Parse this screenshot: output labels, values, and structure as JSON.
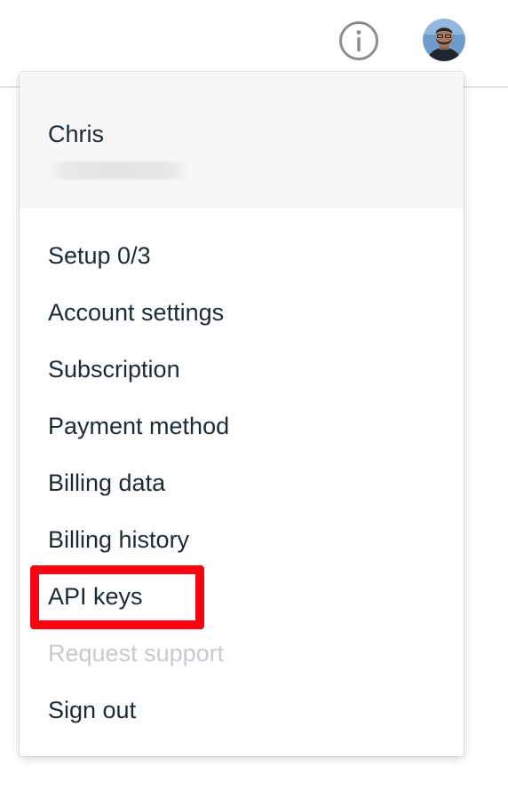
{
  "header": {
    "info_icon": "info-circle-icon",
    "avatar_icon": "user-avatar"
  },
  "menu": {
    "user": {
      "name": "Chris",
      "email": ""
    },
    "items": [
      {
        "label": "Setup 0/3",
        "enabled": true
      },
      {
        "label": "Account settings",
        "enabled": true
      },
      {
        "label": "Subscription",
        "enabled": true
      },
      {
        "label": "Payment method",
        "enabled": true
      },
      {
        "label": "Billing data",
        "enabled": true
      },
      {
        "label": "Billing history",
        "enabled": true
      },
      {
        "label": "API keys",
        "enabled": true,
        "highlighted": true
      },
      {
        "label": "Request support",
        "enabled": false
      },
      {
        "label": "Sign out",
        "enabled": true
      }
    ]
  },
  "colors": {
    "text": "#1d2a33",
    "disabled_text": "#c7cbcf",
    "header_background": "#f7f7f7",
    "highlight": "#ff0012",
    "icon": "#8d8d8d"
  }
}
